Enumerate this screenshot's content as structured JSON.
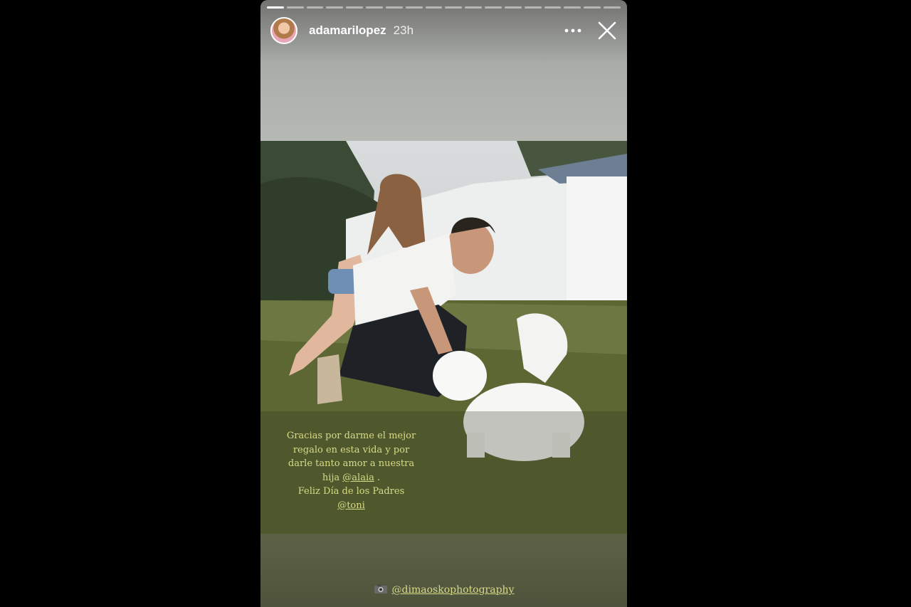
{
  "story": {
    "segment_count": 18,
    "completed_segments": 1,
    "username": "adamarilopez",
    "time": "23h",
    "more_label": "•••",
    "icons": {
      "more": "more-dots-icon",
      "close": "close-icon",
      "camera": "camera-icon"
    },
    "caption": {
      "lines": [
        "Gracias por darme el mejor",
        "regalo en esta vida y por",
        "darle tanto amor a nuestra"
      ],
      "line4_prefix": "hija ",
      "mention1": "@alaia",
      "line4_suffix": " .",
      "line5": "Feliz Día de los Padres",
      "mention2": "@toni"
    },
    "credit": {
      "mention": "@dimaoskophotography"
    },
    "colors": {
      "caption_text": "#d7db88",
      "background": "#000000"
    }
  }
}
